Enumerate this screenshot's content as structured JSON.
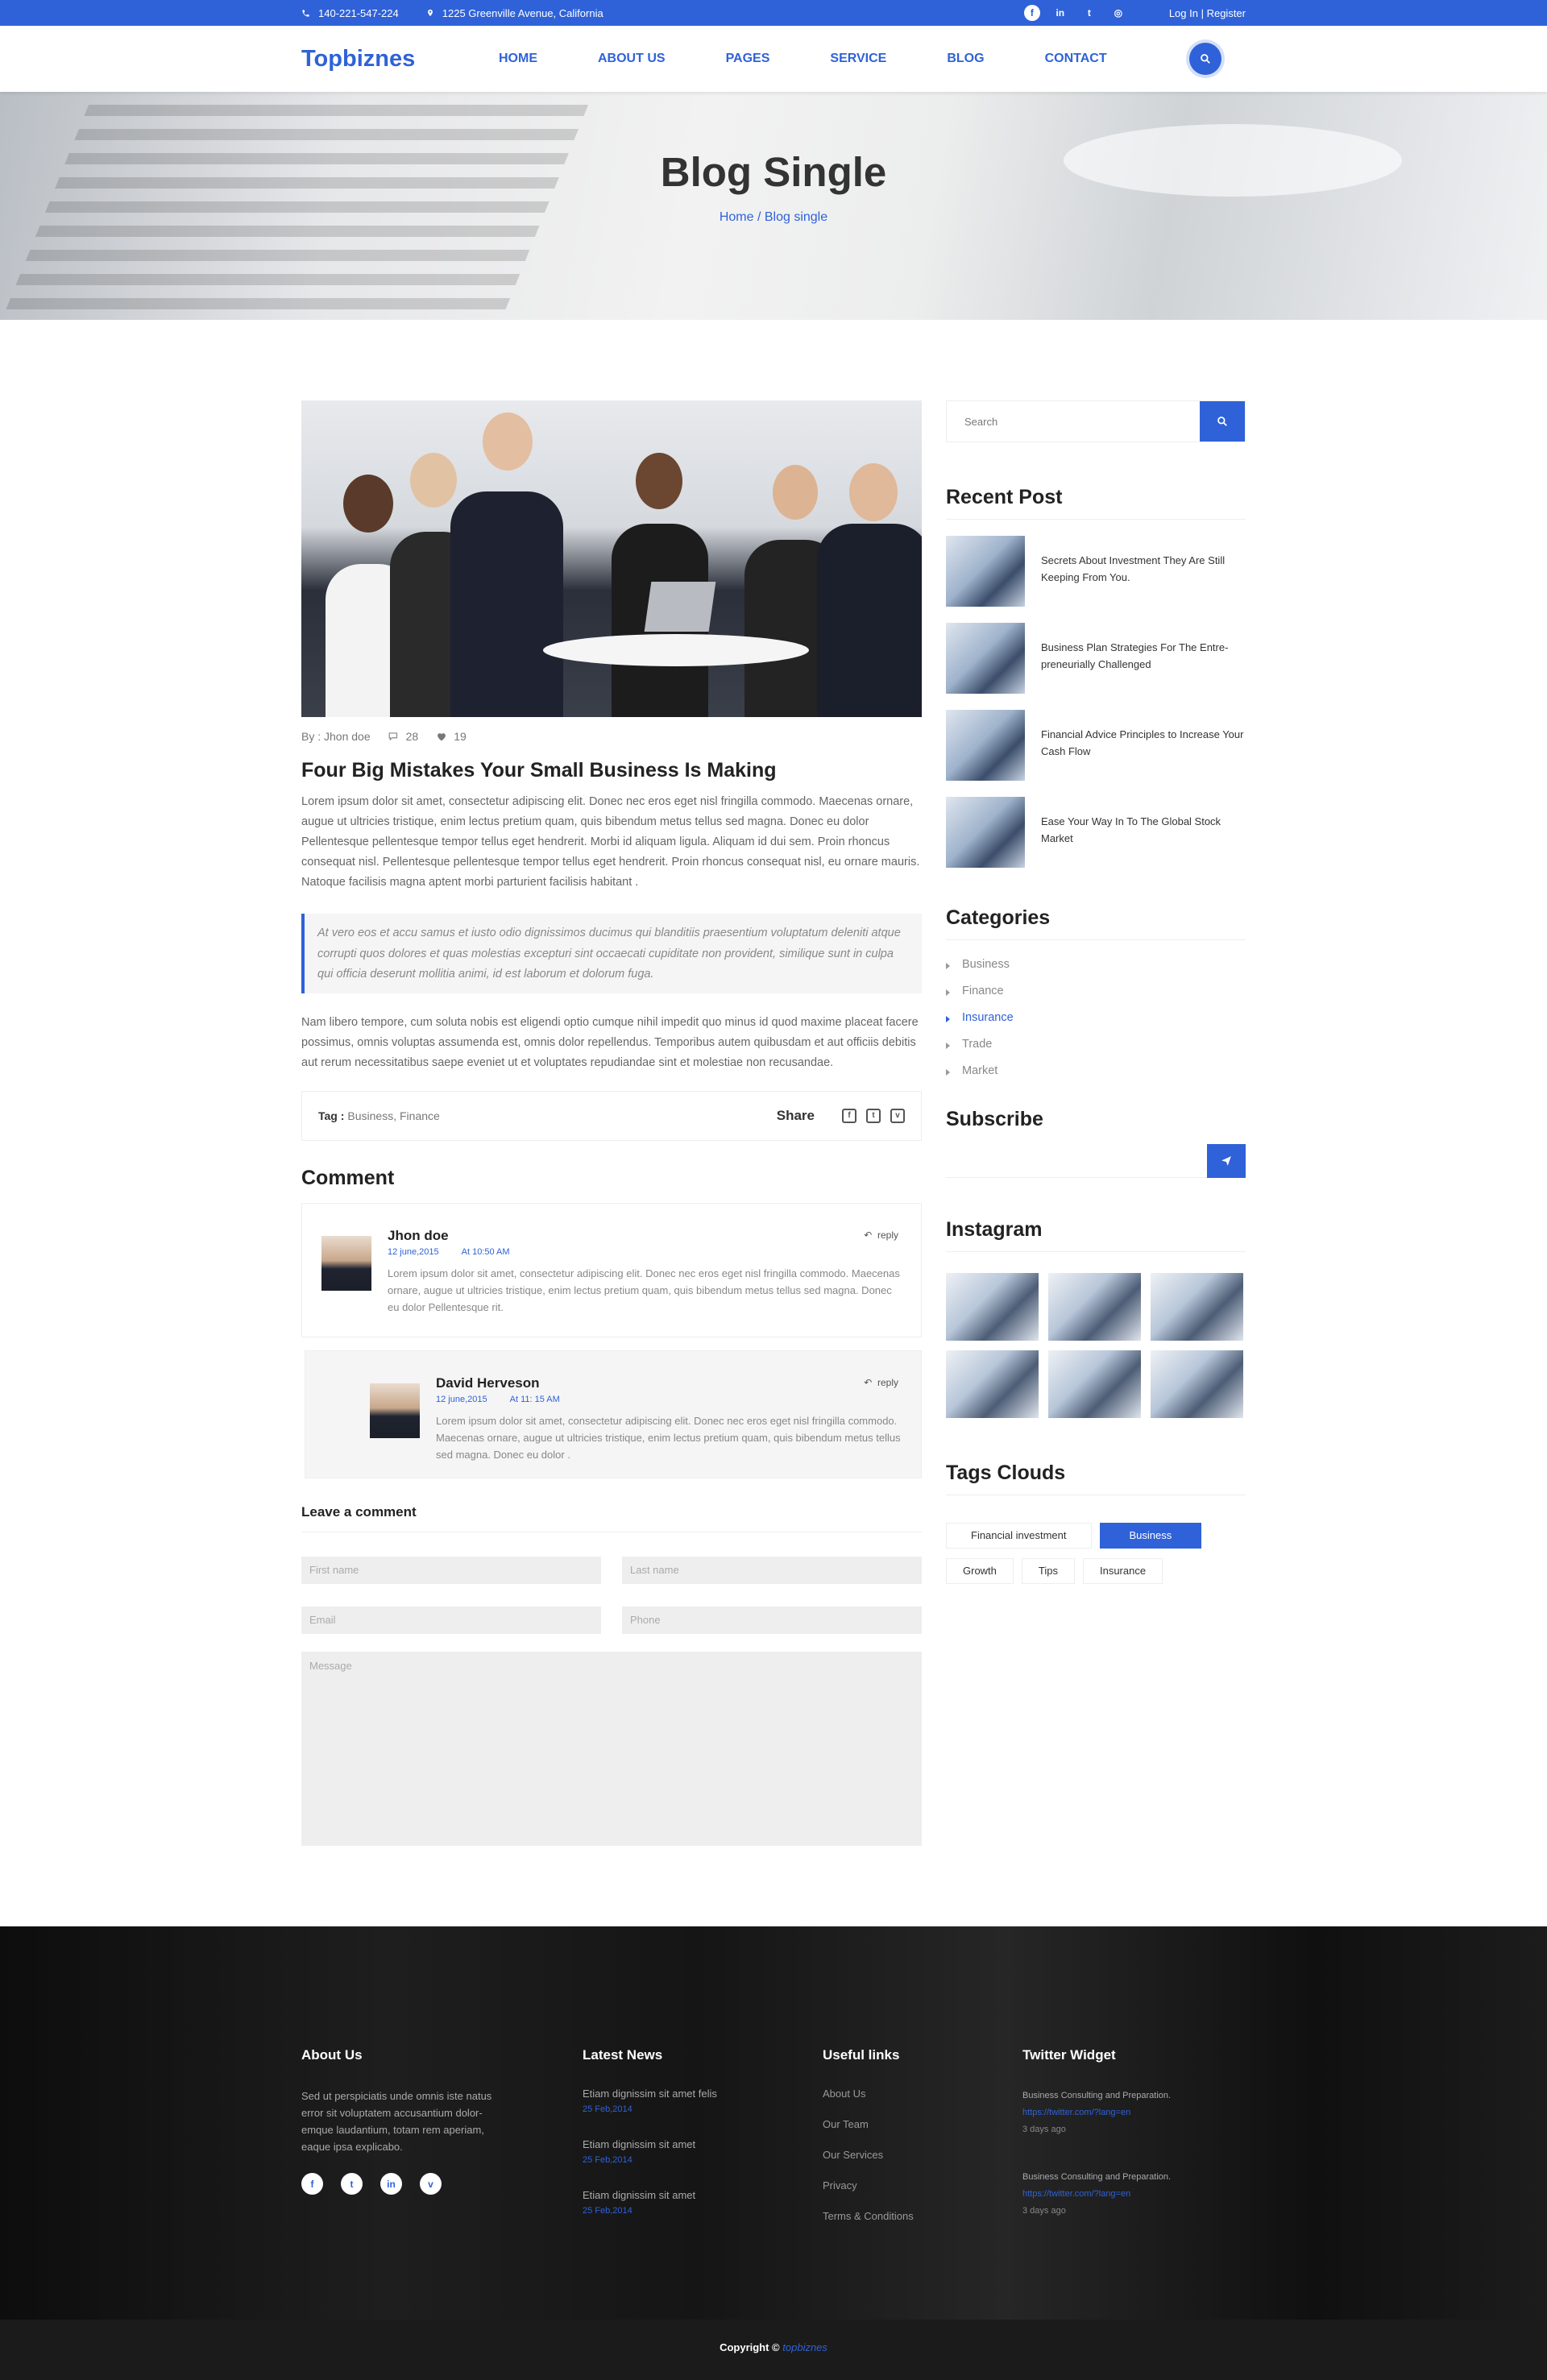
{
  "topbar": {
    "phone": "140-221-547-224",
    "address": "1225 Greenville Avenue, California",
    "social": [
      "facebook-icon",
      "linkedin-icon",
      "twitter-icon",
      "globe-icon"
    ],
    "login": "Log In |",
    "register": "Register"
  },
  "header": {
    "logo": "Topbiznes",
    "nav": [
      "HOME",
      "ABOUT US",
      "PAGES",
      "SERVICE",
      "BLOG",
      "CONTACT"
    ]
  },
  "hero": {
    "title": "Blog Single",
    "breadcrumb": "Home / Blog single"
  },
  "post": {
    "author": "By : Jhon doe",
    "comments_count": "28",
    "likes_count": "19",
    "title": "Four Big Mistakes Your Small Business Is Making",
    "body1": "Lorem ipsum dolor sit amet, consectetur adipiscing elit. Donec nec eros eget nisl fringilla commodo. Maecenas ornare, augue ut ultricies tristique, enim lectus pretium quam, quis bibendum metus tellus sed magna. Donec eu dolor Pellentesque pellentesque tempor tellus eget hendrerit. Morbi id aliquam ligula. Aliquam id dui sem. Proin rhoncus consequat nisl. Pellentesque pellentesque tempor tellus eget hendrerit. Proin rhoncus consequat nisl, eu ornare mauris. Natoque facilisis magna aptent morbi parturient facilisis habitant .",
    "quote": "At vero eos et accu samus et iusto odio dignissimos ducimus qui blanditiis praesentium voluptatum deleniti atque corrupti quos dolores et quas molestias excepturi sint occaecati cupiditate non provident, similique sunt in culpa qui officia deserunt mollitia animi, id est laborum et dolorum fuga.",
    "body2": " Nam libero tempore, cum soluta nobis est eligendi optio cumque nihil impedit quo minus id quod maxime placeat facere possimus, omnis voluptas assumenda est, omnis dolor repellendus. Temporibus autem quibusdam et aut officiis debitis aut rerum necessitatibus saepe eveniet ut et voluptates repudiandae sint et molestiae non recusandae.",
    "tag_label": "Tag :",
    "tags": "Business, Finance",
    "share_label": "Share"
  },
  "comments": {
    "title": "Comment",
    "reply_label": "reply",
    "items": [
      {
        "name": "Jhon doe",
        "date": "12 june,2015",
        "time": "At 10:50 AM",
        "text": "Lorem ipsum dolor sit amet, consectetur adipiscing elit. Donec nec eros eget nisl fringilla commodo. Maecenas ornare, augue ut ultricies tristique, enim lectus pretium quam, quis bibendum metus tellus sed magna. Donec eu dolor Pellentesque rit."
      },
      {
        "name": "David Herveson",
        "date": "12 june,2015",
        "time": "At 11: 15 AM",
        "text": "Lorem ipsum dolor sit amet, consectetur adipiscing elit. Donec nec eros eget nisl fringilla commodo. Maecenas ornare, augue ut ultricies tristique, enim lectus pretium quam, quis bibendum metus tellus sed magna. Donec eu dolor ."
      }
    ]
  },
  "form": {
    "title": "Leave a comment",
    "first_name": "First name",
    "last_name": "Last name",
    "email": "Email",
    "phone": "Phone",
    "message": "Message"
  },
  "sidebar": {
    "search_placeholder": "Search",
    "recent_title": "Recent Post",
    "recent": [
      "Secrets About Investment They Are Still Keeping From You.",
      "Business Plan Strategies For The Entre-preneurially Challenged",
      "Financial Advice Principles to Increase Your Cash Flow",
      "Ease Your Way In To The Global Stock Market"
    ],
    "categories_title": "Categories",
    "categories": [
      "Business",
      "Finance",
      "Insurance",
      "Trade",
      "Market"
    ],
    "subscribe_title": "Subscribe",
    "instagram_title": "Instagram",
    "tags_title": "Tags Clouds",
    "tags": [
      "Financial investment",
      "Business",
      "Growth",
      "Tips",
      "Insurance"
    ]
  },
  "footer": {
    "about_title": "About Us",
    "about_text": "Sed ut perspiciatis unde omnis iste natus error sit voluptatem accusantium dolor-emque laudantium, totam rem aperiam, eaque ipsa  explicabo.",
    "news_title": "Latest News",
    "news": [
      {
        "title": "Etiam dignissim sit amet felis",
        "date": "25 Feb,2014"
      },
      {
        "title": "Etiam dignissim sit amet",
        "date": "25 Feb,2014"
      },
      {
        "title": "Etiam dignissim sit amet",
        "date": "25 Feb,2014"
      }
    ],
    "links_title": "Useful links",
    "links": [
      "About Us",
      "Our Team",
      "Our Services",
      "Privacy",
      "Terms & Conditions"
    ],
    "twitter_title": "Twitter Widget",
    "tweets": [
      {
        "text": "Business Consulting and Preparation.",
        "link": "https://twitter.com/?lang=en",
        "ago": "3 days ago"
      },
      {
        "text": "Business Consulting and Preparation.",
        "link": "https://twitter.com/?lang=en",
        "ago": "3 days ago"
      }
    ],
    "copyright": "Copyright ©",
    "copyright_brand": "topbiznes"
  },
  "colors": {
    "accent": "#2f62d8",
    "footer_bg": "#151515"
  }
}
